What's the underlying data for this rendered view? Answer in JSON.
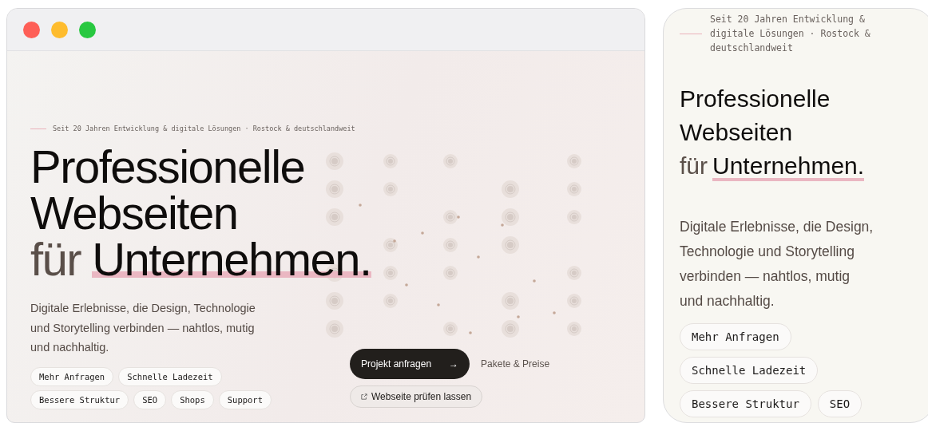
{
  "desktop": {
    "window_controls": [
      {
        "color": "#fe5f57"
      },
      {
        "color": "#febc2e"
      },
      {
        "color": "#28c840"
      }
    ],
    "eyebrow": "Seit 20 Jahren Entwicklung & digitale Lösungen · Rostock & deutschlandweit",
    "headline": {
      "line_1": "Professionelle",
      "line_2": "Webseiten",
      "lead": "für",
      "highlight": "Unternehmen."
    },
    "paragraph": "Digitale Erlebnisse, die Design, Technologie und Storytelling verbinden — nahtlos, mutig und nachhaltig.",
    "chips": [
      "Mehr Anfragen",
      "Schnelle Ladezeit",
      "Bessere Struktur",
      "SEO",
      "Shops",
      "Support"
    ],
    "primary_button": {
      "label": "Projekt anfragen",
      "arrow": "→"
    },
    "secondary_link": "Pakete & Preise",
    "outline_button": "Webseite prüfen lassen"
  },
  "mobile": {
    "eyebrow": "Seit 20 Jahren Entwicklung & digitale Lösungen · Rostock & deutschlandweit",
    "headline": {
      "line_1": "Professionelle",
      "line_2": "Webseiten",
      "lead": "für",
      "highlight": "Unternehmen."
    },
    "paragraph": "Digitale Erlebnisse, die Design, Technologie und Storytelling verbinden — nahtlos, mutig und nachhaltig.",
    "chips": [
      "Mehr Anfragen",
      "Schnelle Ladezeit",
      "Bessere Struktur",
      "SEO"
    ]
  }
}
